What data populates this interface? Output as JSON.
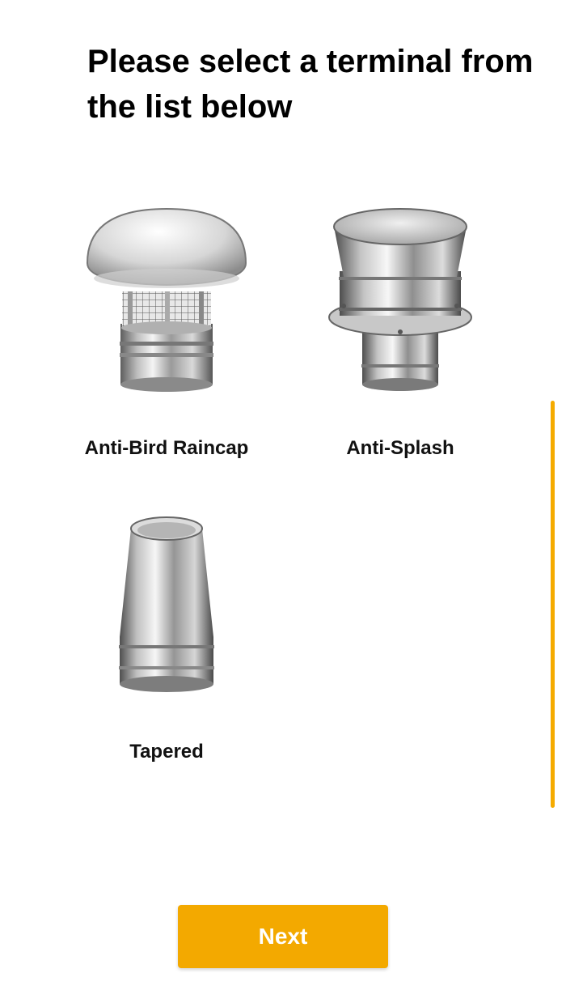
{
  "header": {
    "title": "Please select a terminal from the list below"
  },
  "terminals": [
    {
      "label": "Anti-Bird Raincap",
      "icon": "anti-bird-raincap-icon"
    },
    {
      "label": "Anti-Splash",
      "icon": "anti-splash-icon"
    },
    {
      "label": "Tapered",
      "icon": "tapered-icon"
    }
  ],
  "footer": {
    "next_label": "Next"
  },
  "colors": {
    "accent": "#F3A900",
    "text": "#000000",
    "background": "#FFFFFF"
  }
}
